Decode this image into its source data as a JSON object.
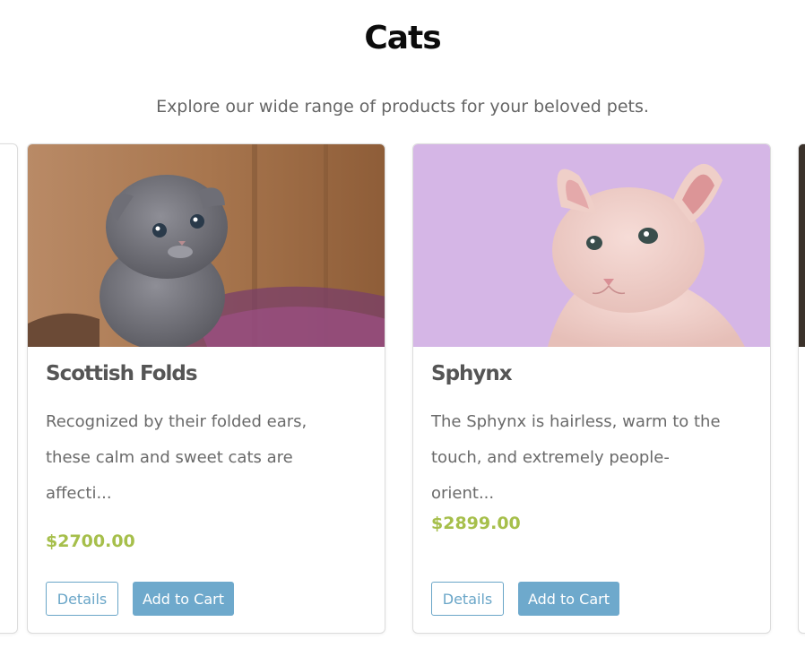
{
  "header": {
    "title": "Cats",
    "subtitle": "Explore our wide range of products for your beloved pets."
  },
  "products": [
    {
      "name": "Scottish Folds",
      "description": "Recognized by their folded ears, these calm and sweet cats are affecti...",
      "price": "$2700.00",
      "details_label": "Details",
      "cart_label": "Add to Cart",
      "image": "gray-kitten-photo"
    },
    {
      "name": "Sphynx",
      "description": "The Sphynx is hairless, warm to the touch, and extremely people-orient...",
      "price": "$2899.00",
      "details_label": "Details",
      "cart_label": "Add to Cart",
      "image": "sphynx-cat-photo"
    }
  ],
  "colors": {
    "price": "#a6bf4b",
    "button_primary": "#6ea9cc",
    "button_outline": "#6aa6c8",
    "title": "#0c0c0c",
    "text": "#6a6a6a"
  }
}
